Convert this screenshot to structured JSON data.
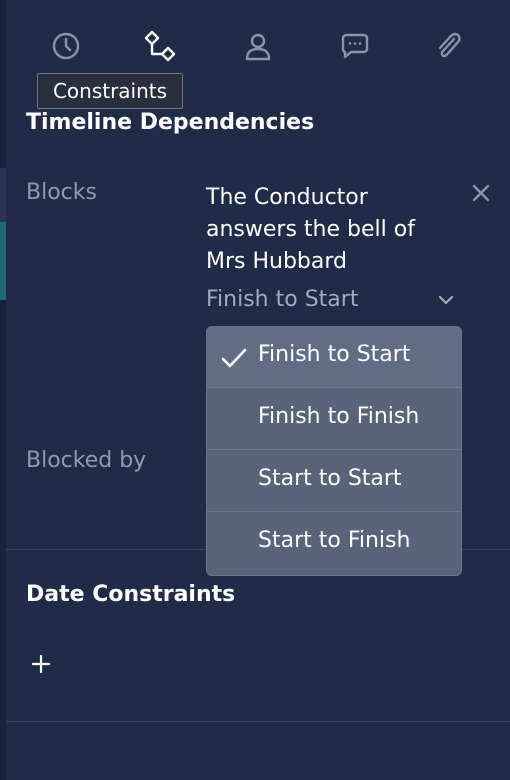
{
  "tabs": [
    {
      "name": "clock-icon"
    },
    {
      "name": "constraints-icon"
    },
    {
      "name": "user-icon"
    },
    {
      "name": "comment-icon"
    },
    {
      "name": "attachment-icon"
    }
  ],
  "tooltip": {
    "text": "Constraints"
  },
  "timeline": {
    "title": "Timeline Dependencies",
    "blocks_label": "Blocks",
    "blocked_by_label": "Blocked by",
    "dependency": {
      "task_name": "The Conductor answers the bell of Mrs Hubbard",
      "type_value": "Finish to Start"
    },
    "type_options": [
      "Finish to Start",
      "Finish to Finish",
      "Start to Start",
      "Start to Finish"
    ],
    "selected_option": "Finish to Start"
  },
  "date_constraints": {
    "title": "Date Constraints",
    "add_icon": "plus-icon"
  },
  "colors": {
    "background": "#202b48",
    "muted_text": "#9099ad",
    "dropdown_bg": "#59647a"
  }
}
